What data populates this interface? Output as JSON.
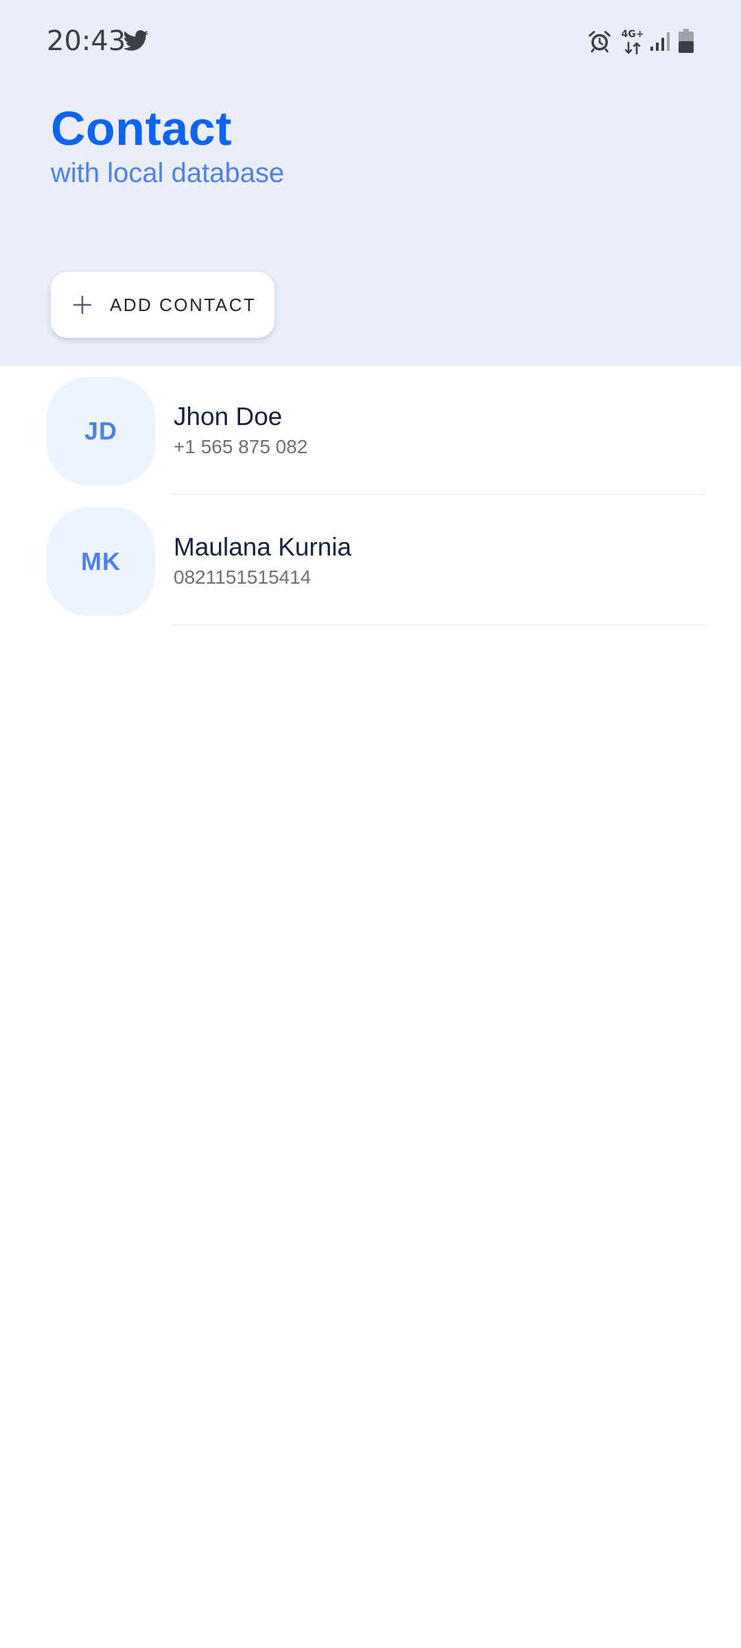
{
  "status_bar": {
    "time": "20:43",
    "network_label": "4G+",
    "icons": [
      "twitter-icon",
      "alarm-icon",
      "network-4g-icon",
      "signal-icon",
      "battery-icon"
    ]
  },
  "header": {
    "title": "Contact",
    "subtitle": "with local database"
  },
  "add_button": {
    "icon": "plus-icon",
    "label": "ADD CONTACT"
  },
  "contacts": [
    {
      "initials": "JD",
      "name": "Jhon Doe",
      "phone": "+1 565 875 082"
    },
    {
      "initials": "MK",
      "name": "Maulana Kurnia",
      "phone": "0821151515414"
    }
  ],
  "colors": {
    "header_bg": "#e9eef9",
    "title": "#0d63f3",
    "subtitle": "#4f7fe8",
    "avatar_bg": "#eef4fe",
    "avatar_text": "#4f7fe8",
    "name_text": "#16213a",
    "phone_text": "#6b6f78"
  }
}
